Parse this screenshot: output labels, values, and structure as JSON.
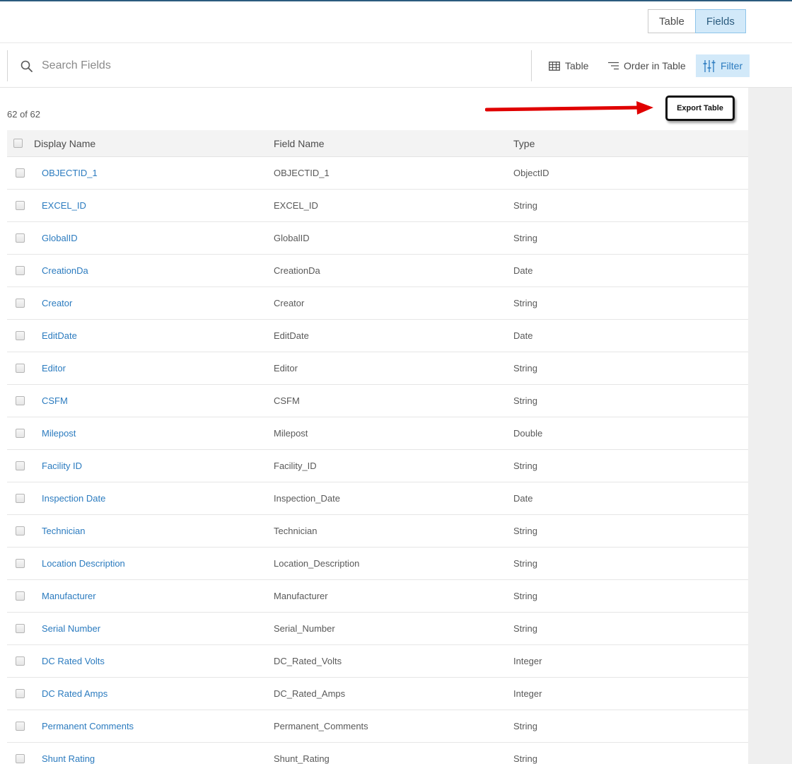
{
  "view_toggle": {
    "table_label": "Table",
    "fields_label": "Fields",
    "active": "Fields"
  },
  "search": {
    "placeholder": "Search Fields"
  },
  "toolbar": {
    "table_label": "Table",
    "order_label": "Order in Table",
    "filter_label": "Filter"
  },
  "count": "62 of 62",
  "export": {
    "label": "Export Table"
  },
  "colors": {
    "link": "#2b7bbf",
    "active_bg": "#d2e9f9",
    "annotation_arrow": "#e00000"
  },
  "table": {
    "headers": {
      "display": "Display Name",
      "field": "Field Name",
      "type": "Type"
    },
    "rows": [
      {
        "display": "OBJECTID_1",
        "field": "OBJECTID_1",
        "type": "ObjectID"
      },
      {
        "display": "EXCEL_ID",
        "field": "EXCEL_ID",
        "type": "String"
      },
      {
        "display": "GlobalID",
        "field": "GlobalID",
        "type": "String"
      },
      {
        "display": "CreationDa",
        "field": "CreationDa",
        "type": "Date"
      },
      {
        "display": "Creator",
        "field": "Creator",
        "type": "String"
      },
      {
        "display": "EditDate",
        "field": "EditDate",
        "type": "Date"
      },
      {
        "display": "Editor",
        "field": "Editor",
        "type": "String"
      },
      {
        "display": "CSFM",
        "field": "CSFM",
        "type": "String"
      },
      {
        "display": "Milepost",
        "field": "Milepost",
        "type": "Double"
      },
      {
        "display": "Facility ID",
        "field": "Facility_ID",
        "type": "String"
      },
      {
        "display": "Inspection Date",
        "field": "Inspection_Date",
        "type": "Date"
      },
      {
        "display": "Technician",
        "field": "Technician",
        "type": "String"
      },
      {
        "display": "Location Description",
        "field": "Location_Description",
        "type": "String"
      },
      {
        "display": "Manufacturer",
        "field": "Manufacturer",
        "type": "String"
      },
      {
        "display": "Serial Number",
        "field": "Serial_Number",
        "type": "String"
      },
      {
        "display": "DC Rated Volts",
        "field": "DC_Rated_Volts",
        "type": "Integer"
      },
      {
        "display": "DC Rated Amps",
        "field": "DC_Rated_Amps",
        "type": "Integer"
      },
      {
        "display": "Permanent Comments",
        "field": "Permanent_Comments",
        "type": "String"
      },
      {
        "display": "Shunt Rating",
        "field": "Shunt_Rating",
        "type": "String"
      }
    ]
  }
}
